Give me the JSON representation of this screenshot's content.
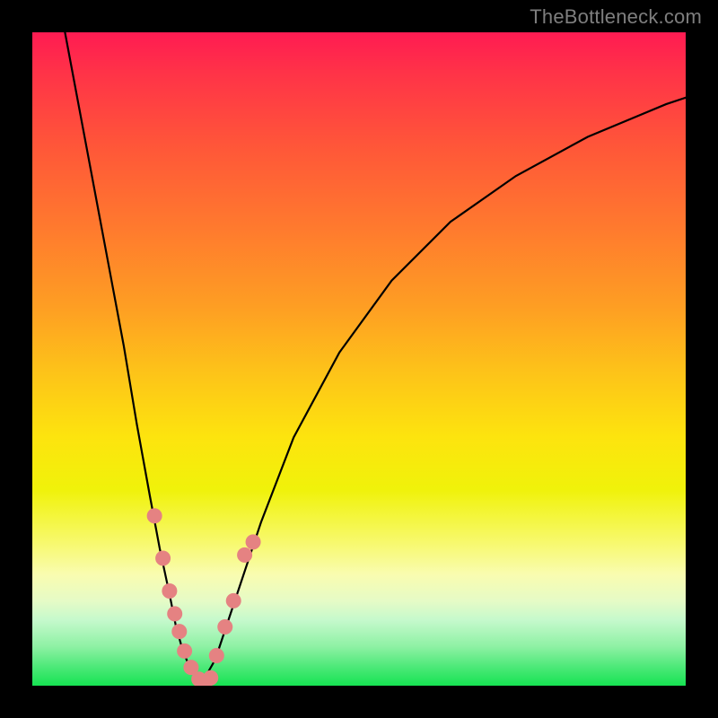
{
  "watermark": "TheBottleneck.com",
  "colors": {
    "curve": "#000000",
    "dots": "#e58282",
    "frame": "#000000",
    "gradient_top": "#ff1b52",
    "gradient_bottom": "#16e352"
  },
  "chart_data": {
    "type": "line",
    "title": "",
    "xlabel": "",
    "ylabel": "",
    "xlim": [
      0,
      100
    ],
    "ylim": [
      0,
      100
    ],
    "series": [
      {
        "name": "left-branch",
        "x": [
          5,
          8,
          11,
          14,
          16,
          18,
          19.5,
          21,
          22,
          23,
          24,
          25,
          26
        ],
        "y": [
          100,
          84,
          68,
          52,
          40,
          29,
          21,
          14,
          9,
          5.5,
          3,
          1.5,
          0.5
        ]
      },
      {
        "name": "right-branch",
        "x": [
          26,
          28,
          31,
          35,
          40,
          47,
          55,
          64,
          74,
          85,
          97,
          100
        ],
        "y": [
          0.5,
          4,
          13,
          25,
          38,
          51,
          62,
          71,
          78,
          84,
          89,
          90
        ]
      }
    ],
    "scatter": [
      {
        "name": "highlight-dots",
        "points": [
          [
            18.7,
            26
          ],
          [
            20.0,
            19.5
          ],
          [
            21.0,
            14.5
          ],
          [
            21.8,
            11
          ],
          [
            22.5,
            8.3
          ],
          [
            23.3,
            5.3
          ],
          [
            24.3,
            2.8
          ],
          [
            25.5,
            1.0
          ],
          [
            26.5,
            0.6
          ],
          [
            27.3,
            1.2
          ],
          [
            28.2,
            4.6
          ],
          [
            29.5,
            9.0
          ],
          [
            30.8,
            13.0
          ],
          [
            32.5,
            20.0
          ],
          [
            33.8,
            22.0
          ]
        ]
      }
    ]
  }
}
